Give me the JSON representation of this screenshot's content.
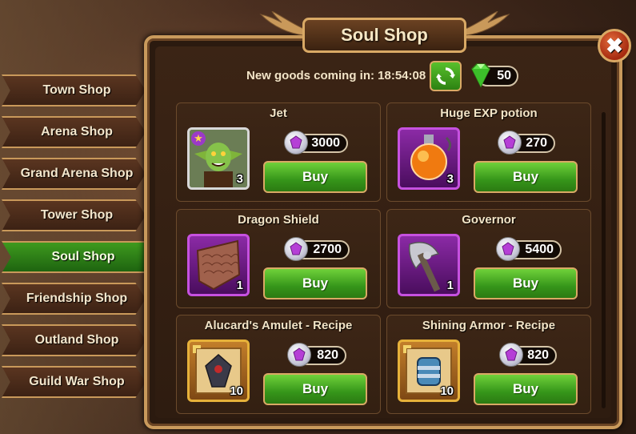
{
  "shop": {
    "title": "Soul Shop",
    "timer_label": "New goods coming in: 18:54:08",
    "gem_count": "50",
    "close_label": "✖"
  },
  "tabs": [
    {
      "label": "Town Shop",
      "active": false
    },
    {
      "label": "Arena Shop",
      "active": false
    },
    {
      "label": "Grand Arena Shop",
      "active": false
    },
    {
      "label": "Tower Shop",
      "active": false
    },
    {
      "label": "Soul Shop",
      "active": true
    },
    {
      "label": "Friendship Shop",
      "active": false
    },
    {
      "label": "Outland Shop",
      "active": false
    },
    {
      "label": "Guild War Shop",
      "active": false
    }
  ],
  "items": [
    {
      "name": "Jet",
      "price": "3000",
      "quantity": "3",
      "buy_label": "Buy",
      "frame": "silver",
      "icon": "goblin-hero-portrait-icon"
    },
    {
      "name": "Huge EXP potion",
      "price": "270",
      "quantity": "3",
      "buy_label": "Buy",
      "frame": "purple",
      "icon": "exp-potion-icon"
    },
    {
      "name": "Dragon Shield",
      "price": "2700",
      "quantity": "1",
      "buy_label": "Buy",
      "frame": "purple",
      "icon": "dragon-shield-icon"
    },
    {
      "name": "Governor",
      "price": "5400",
      "quantity": "1",
      "buy_label": "Buy",
      "frame": "purple",
      "icon": "governor-axe-icon"
    },
    {
      "name": "Alucard's Amulet - Recipe",
      "price": "820",
      "quantity": "10",
      "buy_label": "Buy",
      "frame": "gold",
      "icon": "amulet-recipe-icon"
    },
    {
      "name": "Shining Armor - Recipe",
      "price": "820",
      "quantity": "10",
      "buy_label": "Buy",
      "frame": "gold",
      "icon": "armor-recipe-icon"
    }
  ],
  "colors": {
    "accent_gold": "#d9a965",
    "active_tab_green": "#2d8212",
    "buy_green": "#36961a",
    "rarity_purple": "#c651e0",
    "rarity_gold": "#e6b13a",
    "rarity_silver": "#d8d8d8"
  }
}
